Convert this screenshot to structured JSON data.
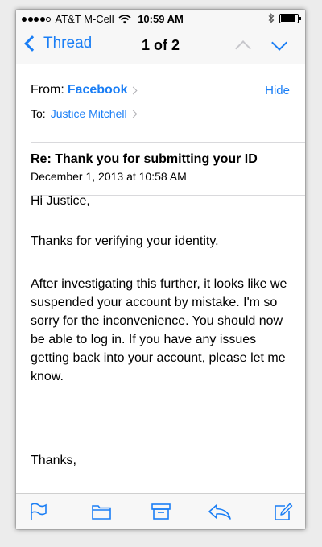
{
  "status": {
    "carrier": "AT&T M-Cell",
    "time": "10:59 AM",
    "signal_bars": 4,
    "signal_total": 5,
    "battery_level": 0.85
  },
  "nav": {
    "back_label": "Thread",
    "title": "1 of 2"
  },
  "header": {
    "from_label": "From:",
    "from_name": "Facebook",
    "hide_label": "Hide",
    "to_label": "To:",
    "to_name": "Justice Mitchell",
    "subject": "Re: Thank you for submitting your ID",
    "date": "December 1, 2013 at 10:58 AM"
  },
  "body": {
    "greeting": "Hi Justice,",
    "p1": "Thanks for verifying your identity.",
    "p2": "After investigating this further, it looks like we suspended your account by mistake. I'm so sorry for the inconvenience. You should now be able to log in. If you have any issues getting back into your account, please let me know.",
    "closing": "Thanks,"
  },
  "toolbar": {
    "icons": [
      "flag-icon",
      "folder-icon",
      "archive-icon",
      "reply-icon",
      "compose-icon"
    ]
  },
  "colors": {
    "accent": "#1a7ef5",
    "bar_bg": "#f7f7f7"
  }
}
